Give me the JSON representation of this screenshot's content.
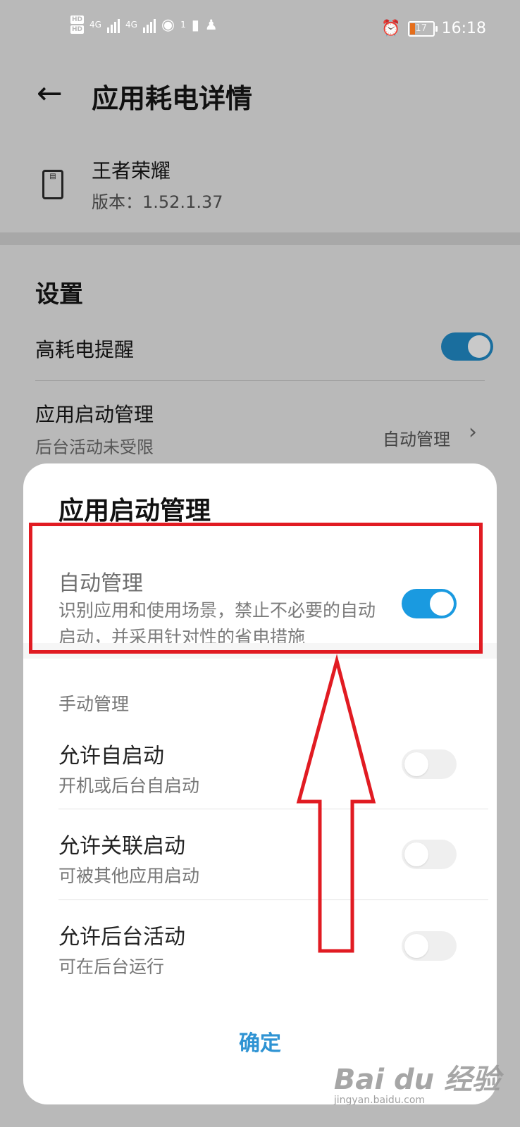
{
  "status_bar": {
    "hd1": "HD",
    "hd2": "HD",
    "net1": "4G",
    "net2": "4G",
    "wifi_badge": "1",
    "battery": "17",
    "time": "16:18"
  },
  "header": {
    "back_icon": "arrow-left-icon",
    "title": "应用耗电详情"
  },
  "app": {
    "name": "王者荣耀",
    "version": "版本：1.52.1.37"
  },
  "settings": {
    "heading": "设置",
    "high_power_alert": "高耗电提醒",
    "launch_mgmt_title": "应用启动管理",
    "launch_mgmt_sub": "后台活动未受限",
    "launch_mgmt_value": "自动管理",
    "chevron": "›"
  },
  "dialog": {
    "title": "应用启动管理",
    "auto": {
      "title": "自动管理",
      "desc": "识别应用和使用场景，禁止不必要的自动启动，并采用针对性的省电措施",
      "enabled": true
    },
    "manual_label": "手动管理",
    "items": [
      {
        "title": "允许自启动",
        "sub": "开机或后台自启动",
        "enabled": false
      },
      {
        "title": "允许关联启动",
        "sub": "可被其他应用启动",
        "enabled": false
      },
      {
        "title": "允许后台活动",
        "sub": "可在后台运行",
        "enabled": false
      }
    ],
    "ok": "确定"
  },
  "watermark": {
    "text": "Bai du 经验",
    "sub": "jingyan.baidu.com"
  },
  "colors": {
    "accent": "#1a9ae0",
    "annotation": "#e11b22"
  }
}
